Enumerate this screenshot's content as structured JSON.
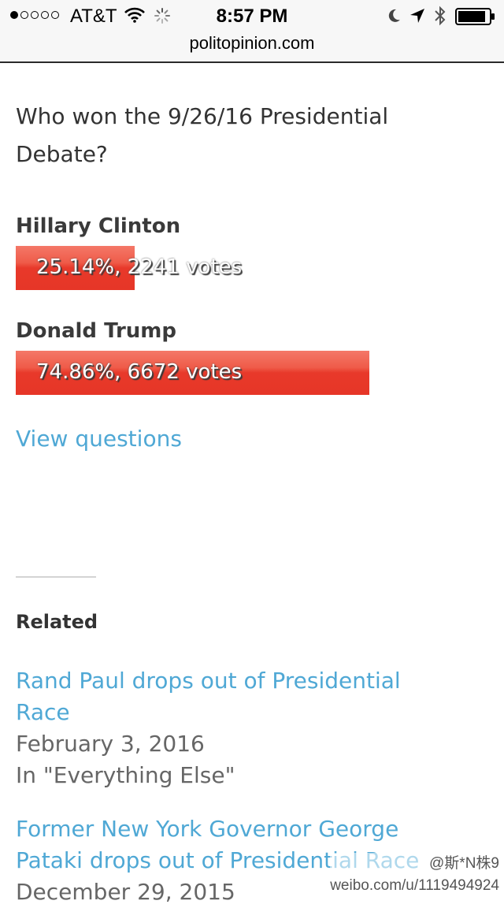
{
  "status_bar": {
    "carrier": "AT&T",
    "time": "8:57 PM"
  },
  "browser": {
    "url": "politopinion.com"
  },
  "poll": {
    "question": "Who won the 9/26/16 Presidential Debate?",
    "options": [
      {
        "name": "Hillary Clinton",
        "result_text": "25.14%, 2241 votes",
        "percent": 25.14,
        "votes": 2241
      },
      {
        "name": "Donald Trump",
        "result_text": "74.86%, 6672 votes",
        "percent": 74.86,
        "votes": 6672
      }
    ],
    "view_questions_label": "View questions"
  },
  "related": {
    "heading": "Related",
    "items": [
      {
        "title": "Rand Paul drops out of Presidential Race",
        "date": "February 3, 2016",
        "category": "In \"Everything Else\""
      },
      {
        "title": "Former New York Governor George Pataki drops out of Presidential Race",
        "date": "December 29, 2015"
      }
    ]
  },
  "watermark": {
    "account": "@斯*N株9",
    "url": "weibo.com/u/1119494924"
  },
  "colors": {
    "bar": "#e8392a",
    "link": "#4fa8d5"
  }
}
